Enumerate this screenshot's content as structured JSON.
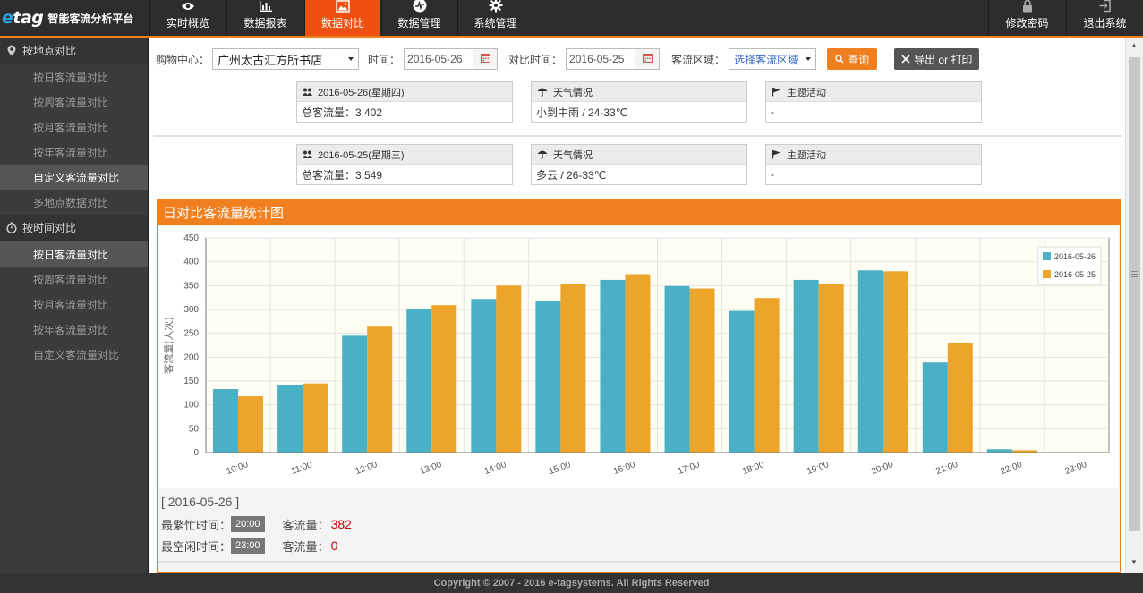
{
  "header": {
    "brand": "tag",
    "brand_e": "e",
    "platform": "智能客流分析平台",
    "nav": [
      {
        "label": "实时概览",
        "icon": "eye-icon"
      },
      {
        "label": "数据报表",
        "icon": "bar-chart-icon"
      },
      {
        "label": "数据对比",
        "icon": "picture-icon"
      },
      {
        "label": "数据管理",
        "icon": "activity-icon"
      },
      {
        "label": "系统管理",
        "icon": "gear-icon"
      }
    ],
    "right": [
      {
        "label": "修改密码",
        "icon": "lock-icon"
      },
      {
        "label": "退出系统",
        "icon": "exit-icon"
      }
    ],
    "active_color": "#f0500f"
  },
  "sidebar": {
    "groups": [
      {
        "label": "按地点对比",
        "icon": "location-pin-icon",
        "items": [
          "按日客流量对比",
          "按周客流量对比",
          "按月客流量对比",
          "按年客流量对比",
          "自定义客流量对比",
          "多地点数据对比"
        ],
        "active": 4
      },
      {
        "label": "按时间对比",
        "icon": "stopwatch-icon",
        "items": [
          "按日客流量对比",
          "按周客流量对比",
          "按月客流量对比",
          "按年客流量对比",
          "自定义客流量对比"
        ],
        "active": 0
      }
    ]
  },
  "filters": {
    "mall_label": "购物中心：",
    "mall_value": "广州太古汇方所书店",
    "time_label": "时间：",
    "time_value": "2016-05-26",
    "compare_label": "对比时间：",
    "compare_value": "2016-05-25",
    "area_label": "客流区域：",
    "area_value": "选择客流区域",
    "query_label": "查询",
    "export_label": "导出 or 打印"
  },
  "day1": {
    "date": "2016-05-26(星期四)",
    "total": "总客流量：3,402",
    "weather_title": "天气情况",
    "weather": "小到中雨 / 24-33℃",
    "activity_title": "主题活动",
    "activity": "-"
  },
  "day2": {
    "date": "2016-05-25(星期三)",
    "total": "总客流量：3,549",
    "weather_title": "天气情况",
    "weather": "多云 / 26-33℃",
    "activity_title": "主题活动",
    "activity": "-"
  },
  "panel_title": "日对比客流量统计图",
  "chart_data": {
    "type": "bar",
    "categories": [
      "10:00",
      "11:00",
      "12:00",
      "13:00",
      "14:00",
      "15:00",
      "16:00",
      "17:00",
      "18:00",
      "19:00",
      "20:00",
      "21:00",
      "22:00",
      "23:00"
    ],
    "series": [
      {
        "name": "2016-05-26",
        "color": "#4ab0c5",
        "values": [
          133,
          142,
          245,
          301,
          322,
          318,
          362,
          349,
          297,
          362,
          382,
          189,
          7,
          0
        ]
      },
      {
        "name": "2016-05-25",
        "color": "#eca42b",
        "values": [
          118,
          145,
          264,
          309,
          350,
          354,
          374,
          344,
          324,
          354,
          380,
          230,
          5,
          0
        ]
      }
    ],
    "ylabel": "客流量(人次)",
    "ylim": [
      0,
      450
    ],
    "yticks": [
      0,
      50,
      100,
      150,
      200,
      250,
      300,
      350,
      400,
      450
    ],
    "grid": true,
    "legend": "top-right"
  },
  "stats": {
    "date": "[ 2016-05-26 ]",
    "busiest_label": "最繁忙时间：",
    "busiest_time": "20:00",
    "busiest_count_label": "客流量：",
    "busiest_count": "382",
    "idlest_label": "最空闲时间：",
    "idlest_time": "23:00",
    "idlest_count_label": "客流量：",
    "idlest_count": "0"
  },
  "footer": "Copyright © 2007 - 2016 e-tagsystems. All Rights Reserved"
}
